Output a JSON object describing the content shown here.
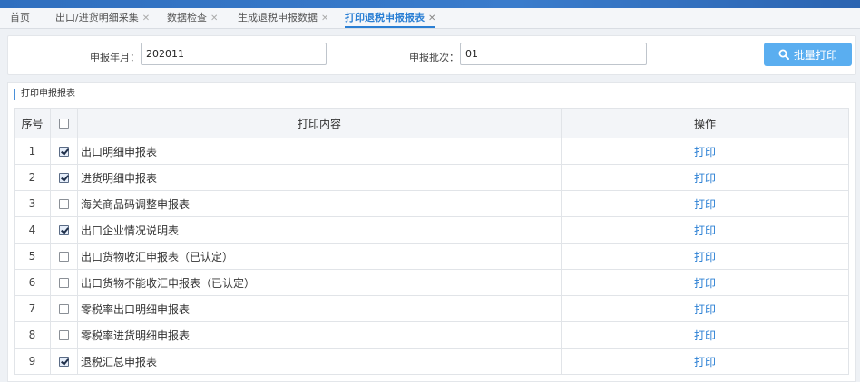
{
  "tabs": [
    {
      "label": "首页",
      "closable": false,
      "active": false
    },
    {
      "label": "出口/进货明细采集",
      "closable": true,
      "active": false
    },
    {
      "label": "数据检查",
      "closable": true,
      "active": false
    },
    {
      "label": "生成退税申报数据",
      "closable": true,
      "active": false
    },
    {
      "label": "打印退税申报报表",
      "closable": true,
      "active": true
    }
  ],
  "close_glyph": "✕",
  "form": {
    "period_label": "申报年月：",
    "period_value": "202011",
    "batch_label": "申报批次：",
    "batch_value": "01",
    "batch_print_label": "批量打印"
  },
  "section_title": "打印申报报表",
  "table": {
    "headers": {
      "index": "序号",
      "content": "打印内容",
      "action": "操作"
    },
    "rows": [
      {
        "index": "1",
        "name": "出口明细申报表",
        "checked": true,
        "action": "打印"
      },
      {
        "index": "2",
        "name": "进货明细申报表",
        "checked": true,
        "action": "打印"
      },
      {
        "index": "3",
        "name": "海关商品码调整申报表",
        "checked": false,
        "action": "打印"
      },
      {
        "index": "4",
        "name": "出口企业情况说明表",
        "checked": true,
        "action": "打印"
      },
      {
        "index": "5",
        "name": "出口货物收汇申报表（已认定）",
        "checked": false,
        "action": "打印"
      },
      {
        "index": "6",
        "name": "出口货物不能收汇申报表（已认定）",
        "checked": false,
        "action": "打印"
      },
      {
        "index": "7",
        "name": "零税率出口明细申报表",
        "checked": false,
        "action": "打印"
      },
      {
        "index": "8",
        "name": "零税率进货明细申报表",
        "checked": false,
        "action": "打印"
      },
      {
        "index": "9",
        "name": "退税汇总申报表",
        "checked": true,
        "action": "打印"
      }
    ]
  },
  "colors": {
    "accent": "#2a7fd4",
    "button": "#5aaef0"
  },
  "icons": {
    "batch_print": "search-icon",
    "row_checkbox": "checkbox",
    "header_checkbox": "checkbox"
  }
}
